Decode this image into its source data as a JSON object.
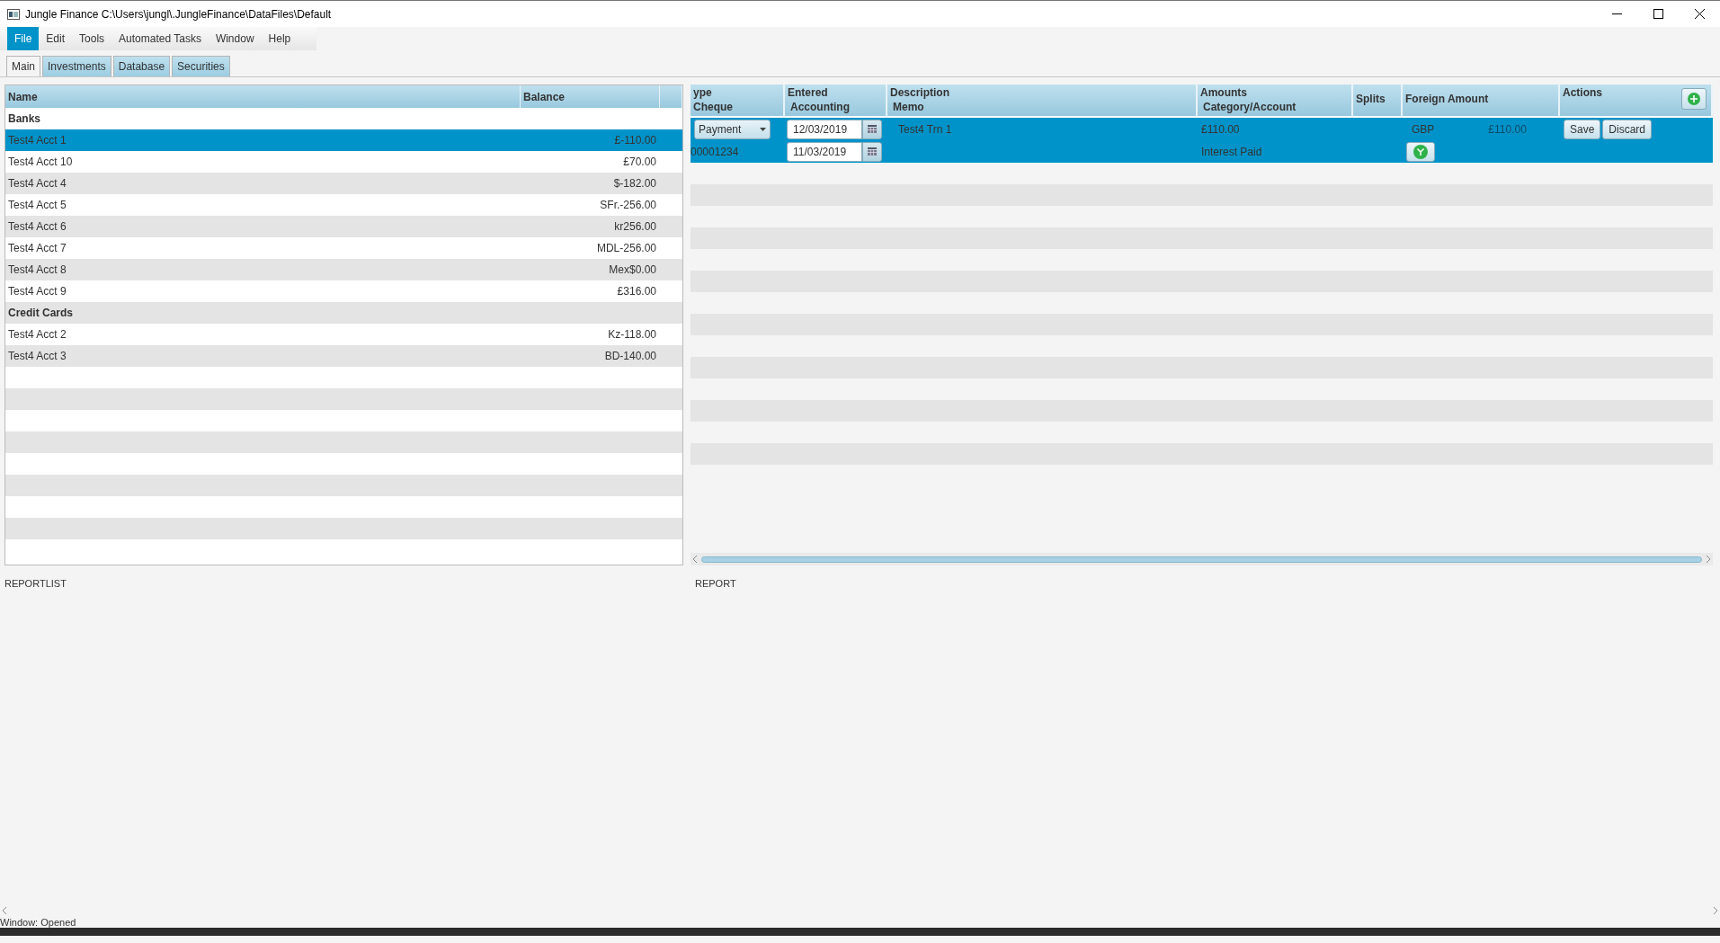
{
  "window": {
    "title": "Jungle Finance C:\\Users\\jungl\\.JungleFinance\\DataFiles\\Default"
  },
  "menu": [
    {
      "label": "File",
      "selected": true
    },
    {
      "label": "Edit",
      "selected": false
    },
    {
      "label": "Tools",
      "selected": false
    },
    {
      "label": "Automated Tasks",
      "selected": false
    },
    {
      "label": "Window",
      "selected": false
    },
    {
      "label": "Help",
      "selected": false
    }
  ],
  "tabs": [
    {
      "label": "Main",
      "selected": true
    },
    {
      "label": "Investments",
      "selected": false
    },
    {
      "label": "Database",
      "selected": false
    },
    {
      "label": "Securities",
      "selected": false
    }
  ],
  "accounts": {
    "columns": [
      "Name",
      "Balance"
    ],
    "rows": [
      {
        "kind": "group",
        "name": "Banks"
      },
      {
        "kind": "account",
        "name": "Test4 Acct 1",
        "balance": "£-110.00",
        "selected": true
      },
      {
        "kind": "account",
        "name": "Test4 Acct 10",
        "balance": "£70.00",
        "selected": false
      },
      {
        "kind": "account",
        "name": "Test4 Acct 4",
        "balance": "$-182.00",
        "selected": false
      },
      {
        "kind": "account",
        "name": "Test4 Acct 5",
        "balance": "SFr.-256.00",
        "selected": false
      },
      {
        "kind": "account",
        "name": "Test4 Acct 6",
        "balance": "kr256.00",
        "selected": false
      },
      {
        "kind": "account",
        "name": "Test4 Acct 7",
        "balance": "MDL-256.00",
        "selected": false
      },
      {
        "kind": "account",
        "name": "Test4 Acct 8",
        "balance": "Mex$0.00",
        "selected": false
      },
      {
        "kind": "account",
        "name": "Test4 Acct 9",
        "balance": "£316.00",
        "selected": false
      },
      {
        "kind": "group",
        "name": "Credit Cards"
      },
      {
        "kind": "account",
        "name": "Test4 Acct 2",
        "balance": "Kz-118.00",
        "selected": false
      },
      {
        "kind": "account",
        "name": "Test4 Acct 3",
        "balance": "BD-140.00",
        "selected": false
      }
    ]
  },
  "register": {
    "columns": [
      {
        "line1": "ype",
        "line2": "Cheque"
      },
      {
        "line1": "Entered",
        "line2": "Accounting"
      },
      {
        "line1": "Description",
        "line2": "Memo"
      },
      {
        "line1": "Amounts",
        "line2": "Category/Account"
      },
      {
        "line1": "Splits"
      },
      {
        "line1": "Foreign Amount"
      },
      {
        "line1": "Actions"
      }
    ],
    "transactions": [
      {
        "selected": true,
        "type": "Payment",
        "cheque": "00001234",
        "entered": "12/03/2019",
        "accounting": "11/03/2019",
        "description": "Test4 Trn 1",
        "amount": "£110.00",
        "category": "Interest Paid",
        "currency": "GBP",
        "foreign_amount": "£110.00",
        "foreign_disabled": true,
        "buttons": [
          "Save",
          "Discard"
        ]
      }
    ]
  },
  "panels": {
    "left": "REPORTLIST",
    "right": "REPORT"
  },
  "status_bar": "Window: Opened"
}
